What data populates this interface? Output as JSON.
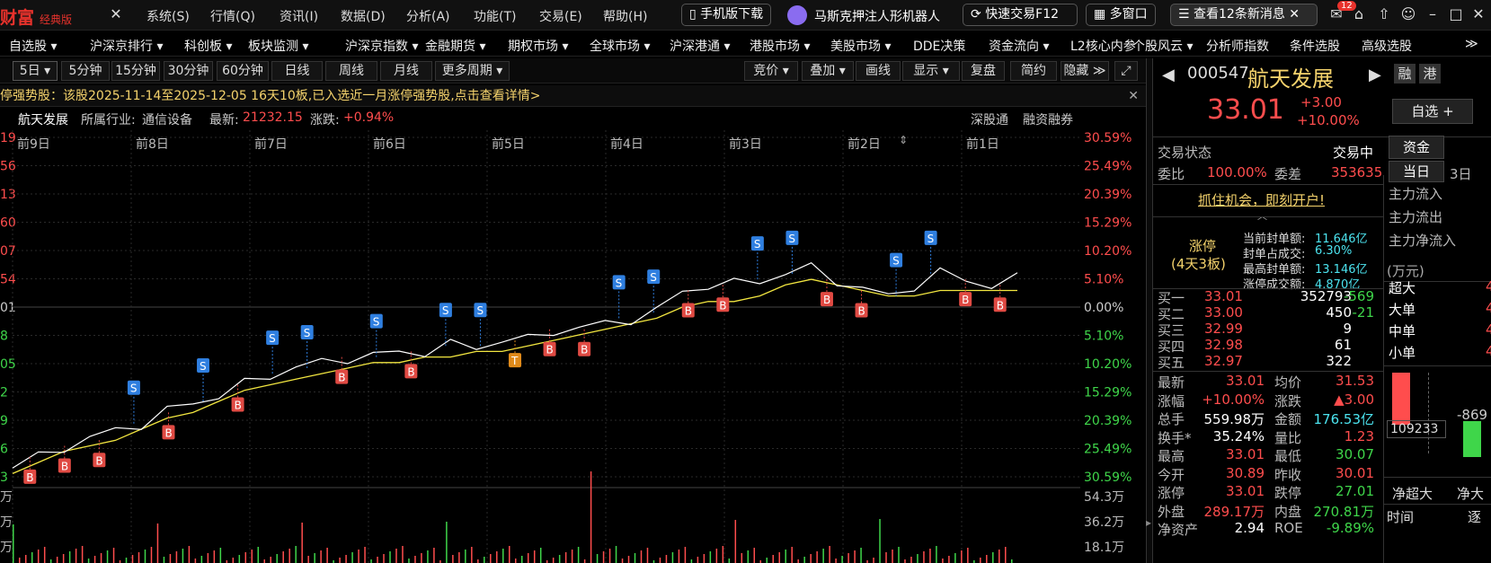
{
  "app": {
    "logo": "财富",
    "edition": "经典版"
  },
  "top_menu": [
    "系统(S)",
    "行情(Q)",
    "资讯(I)",
    "数据(D)",
    "分析(A)",
    "功能(T)",
    "交易(E)",
    "帮助(H)"
  ],
  "top_pills": {
    "mobile": "手机版下载",
    "robot": "马斯克押注人形机器人",
    "quicktrade": "快速交易F12",
    "multiwin": "多窗口",
    "messages": "查看12条新消息",
    "msg_badge": "12"
  },
  "nav": [
    "自选股 ▾",
    "沪深京排行 ▾",
    "科创板 ▾",
    "板块监测 ▾",
    "沪深京指数 ▾",
    "金融期货 ▾",
    "期权市场 ▾",
    "全球市场 ▾",
    "沪深港通 ▾",
    "港股市场 ▾",
    "美股市场 ▾",
    "DDE决策",
    "资金流向 ▾",
    "L2核心内参",
    "个股风云 ▾",
    "分析师指数",
    "条件选股",
    "高级选股",
    "≫"
  ],
  "periods": [
    "5日 ▾",
    "5分钟",
    "15分钟",
    "30分钟",
    "60分钟",
    "日线",
    "周线",
    "月线",
    "更多周期 ▾"
  ],
  "tools": [
    "竞价 ▾",
    "叠加 ▾",
    "画线",
    "显示 ▾",
    "复盘",
    "简约",
    "隐藏 ≫"
  ],
  "notice": "停强势股：该股2025-11-14至2025-12-05 16天10板,已入选近一月涨停强势股,点击查看详情>",
  "info": {
    "name": "航天发展",
    "industry_label": "所属行业:",
    "industry": "通信设备",
    "latest_label": "最新:",
    "latest": "21232.15",
    "change_label": "涨跌:",
    "change": "+0.94%",
    "sgt": "深股通",
    "margin": "融资融券"
  },
  "chart_data": {
    "type": "line",
    "x_labels": [
      "前9日",
      "前8日",
      "前7日",
      "前6日",
      "前5日",
      "前4日",
      "前3日",
      "前2日",
      "前1日"
    ],
    "left_ticks": [
      "19",
      "56",
      "13",
      "60",
      "07",
      "54",
      "01",
      "8",
      "05",
      "2",
      "9",
      "6",
      "3"
    ],
    "y_ticks_pct": [
      "30.59%",
      "25.49%",
      "20.39%",
      "15.29%",
      "10.20%",
      "5.10%",
      "0.00%",
      "5.10%",
      "10.20%",
      "15.29%",
      "20.39%",
      "25.49%",
      "30.59%"
    ],
    "ylim_pct": [
      -30.59,
      30.59
    ],
    "volume_ticks": [
      "54.3万",
      "36.2万",
      "18.1万"
    ],
    "volume_left_ticks": [
      "万",
      "万",
      "万"
    ],
    "price_series": [
      -29,
      -27,
      -25,
      -24,
      -22,
      -21,
      -19,
      -17,
      -16,
      -14,
      -12,
      -11,
      -10,
      -9,
      -9,
      -8,
      -8,
      -7,
      -7,
      -6,
      -6,
      -4,
      -4,
      -3,
      -2,
      -1,
      3,
      4,
      4,
      5,
      6,
      7,
      5,
      3,
      2,
      4,
      6,
      5,
      4,
      5
    ],
    "avg_series": [
      -30,
      -28,
      -26,
      -25,
      -24,
      -22,
      -20,
      -19,
      -17,
      -15,
      -14,
      -13,
      -12,
      -11,
      -10,
      -10,
      -9,
      -9,
      -8,
      -8,
      -7,
      -6,
      -5,
      -4,
      -3,
      -2,
      0,
      1,
      1,
      2,
      4,
      5,
      4,
      3,
      2,
      2,
      3,
      3,
      3,
      3
    ],
    "markers": [
      {
        "t": "B"
      },
      {
        "t": "B"
      },
      {
        "t": "B"
      },
      {
        "t": "S"
      },
      {
        "t": "B"
      },
      {
        "t": "S"
      },
      {
        "t": "B"
      },
      {
        "t": "S"
      },
      {
        "t": "S"
      },
      {
        "t": "B"
      },
      {
        "t": "S"
      },
      {
        "t": "B"
      },
      {
        "t": "S"
      },
      {
        "t": "S"
      },
      {
        "t": "T"
      },
      {
        "t": "B"
      },
      {
        "t": "B"
      },
      {
        "t": "S"
      },
      {
        "t": "S"
      },
      {
        "t": "B"
      },
      {
        "t": "B"
      },
      {
        "t": "S"
      },
      {
        "t": "S"
      },
      {
        "t": "B"
      },
      {
        "t": "B"
      },
      {
        "t": "S"
      },
      {
        "t": "S"
      },
      {
        "t": "B"
      },
      {
        "t": "B"
      }
    ]
  },
  "rp": {
    "code": "000547",
    "name": "航天发展",
    "fav": "融",
    "hk": "港",
    "price": "33.01",
    "chg": "+3.00",
    "chg_pct": "+10.00%",
    "zixuan": "自选 +",
    "status_label": "交易状态",
    "status": "交易中",
    "tab1": "资金",
    "webi_label": "委比",
    "webi": "100.00%",
    "weicha_label": "委差",
    "weicha": "353635",
    "day_tab": "当日",
    "d3_tab": "3日",
    "promo": "抓住机会，即刻开户!",
    "limit_title": "涨停",
    "limit_sub": "(4天3板)",
    "limit_rows": [
      {
        "k": "当前封单额:",
        "v": "11.646亿"
      },
      {
        "k": "封单占成交:",
        "v": "6.30%"
      },
      {
        "k": "最高封单额:",
        "v": "13.146亿"
      },
      {
        "k": "涨停成交额:",
        "v": "4.870亿"
      }
    ],
    "flow_labels": [
      "主力流入",
      "主力流出",
      "主力净流入"
    ],
    "unit": "(万元)",
    "sizes": [
      {
        "k": "超大",
        "v": "4"
      },
      {
        "k": "大单",
        "v": "4"
      },
      {
        "k": "中单",
        "v": "4"
      },
      {
        "k": "小单",
        "v": "4"
      }
    ],
    "bids": [
      {
        "k": "买一",
        "p": "33.01",
        "v": "352793",
        "d": "-569"
      },
      {
        "k": "买二",
        "p": "33.00",
        "v": "450",
        "d": "-21"
      },
      {
        "k": "买三",
        "p": "32.99",
        "v": "9",
        "d": ""
      },
      {
        "k": "买四",
        "p": "32.98",
        "v": "61",
        "d": ""
      },
      {
        "k": "买五",
        "p": "32.97",
        "v": "322",
        "d": ""
      }
    ],
    "stats": [
      {
        "k1": "最新",
        "v1": "33.01",
        "k2": "均价",
        "v2": "31.53"
      },
      {
        "k1": "涨幅",
        "v1": "+10.00%",
        "k2": "涨跌",
        "v2": "▲3.00"
      },
      {
        "k1": "总手",
        "v1": "559.98万",
        "k2": "金额",
        "v2": "176.53亿"
      },
      {
        "k1": "换手*",
        "v1": "35.24%",
        "k2": "量比",
        "v2": "1.23"
      },
      {
        "k1": "最高",
        "v1": "33.01",
        "k2": "最低",
        "v2": "30.07"
      },
      {
        "k1": "今开",
        "v1": "30.89",
        "k2": "昨收",
        "v2": "30.01"
      },
      {
        "k1": "涨停",
        "v1": "33.01",
        "k2": "跌停",
        "v2": "27.01"
      },
      {
        "k1": "外盘",
        "v1": "289.17万",
        "k2": "内盘",
        "v2": "270.81万"
      },
      {
        "k1": "净资产",
        "v1": "2.94",
        "k2": "ROE",
        "v2": "-9.89%"
      }
    ],
    "bar_value1": "109233",
    "bar_value2": "-869",
    "net_super": "净超大",
    "net_big": "净大",
    "time_label": "时间",
    "zhubi": "逐"
  },
  "colors": {
    "up": "#ff4d4d",
    "down": "#3fd64a",
    "price_line": "#ffffff",
    "avg_line": "#f2e640",
    "grid": "#2a2a2a",
    "marker_b": "#e04a43",
    "marker_s": "#2f7fe0",
    "marker_t": "#e08a1a"
  }
}
